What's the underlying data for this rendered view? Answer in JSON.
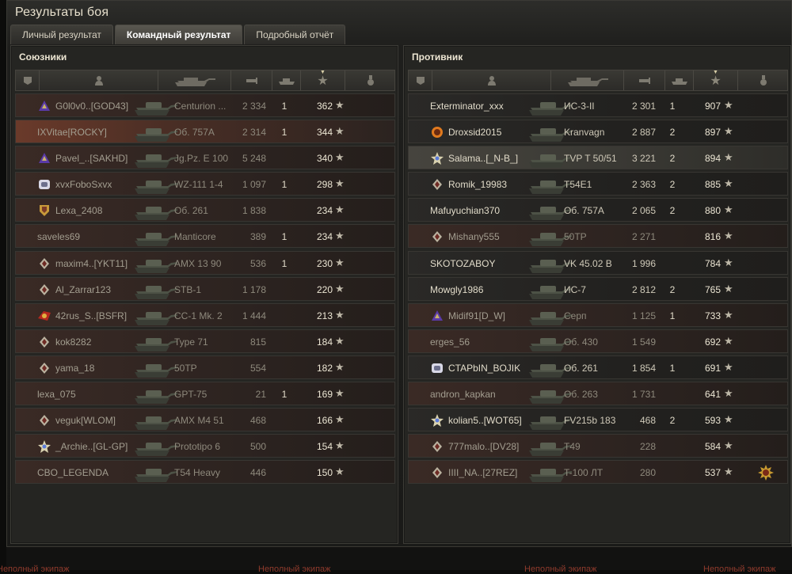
{
  "window": {
    "title": "Результаты боя"
  },
  "tabs": [
    {
      "label": "Личный результат"
    },
    {
      "label": "Командный результат"
    },
    {
      "label": "Подробный отчёт"
    }
  ],
  "allies": {
    "title": "Союзники",
    "rows": [
      {
        "player": "G0l0v0..[GOD43]",
        "tank": "Centurion ...",
        "damage": "2 334",
        "kills": "1",
        "xp": "362",
        "badge": "purple-badge-icon",
        "state": "dead"
      },
      {
        "player": "IXVitae[ROCKY]",
        "tank": "Об. 757А",
        "damage": "2 314",
        "kills": "1",
        "xp": "344",
        "badge": "",
        "state": "me"
      },
      {
        "player": "Pavel_..[SAKHD]",
        "tank": "Jg.Pz. E 100",
        "damage": "5 248",
        "kills": "",
        "xp": "340",
        "badge": "purple-badge-icon",
        "state": "dead"
      },
      {
        "player": "xvxFoboSxvx",
        "tank": "WZ-111 1-4",
        "damage": "1 097",
        "kills": "1",
        "xp": "298",
        "badge": "white-badge-icon",
        "state": "dead"
      },
      {
        "player": "Lexa_2408",
        "tank": "Об. 261",
        "damage": "1 838",
        "kills": "",
        "xp": "234",
        "badge": "gold-shield-icon",
        "state": "dead"
      },
      {
        "player": "saveles69",
        "tank": "Manticore",
        "damage": "389",
        "kills": "1",
        "xp": "234",
        "badge": "",
        "state": "dead"
      },
      {
        "player": "maxim4..[YKT11]",
        "tank": "AMX 13 90",
        "damage": "536",
        "kills": "1",
        "xp": "230",
        "badge": "diamond-icon",
        "state": "dead"
      },
      {
        "player": "Al_Zarrar123",
        "tank": "STB-1",
        "damage": "1 178",
        "kills": "",
        "xp": "220",
        "badge": "diamond-icon",
        "state": "dead"
      },
      {
        "player": "42rus_S..[BSFR]",
        "tank": "CC-1 Mk. 2",
        "damage": "1 444",
        "kills": "",
        "xp": "213",
        "badge": "red-badge-icon",
        "state": "dead"
      },
      {
        "player": "kok8282",
        "tank": "Type 71",
        "damage": "815",
        "kills": "",
        "xp": "184",
        "badge": "diamond-icon",
        "state": "dead"
      },
      {
        "player": "yama_18",
        "tank": "50TP",
        "damage": "554",
        "kills": "",
        "xp": "182",
        "badge": "diamond-icon",
        "state": "dead"
      },
      {
        "player": "lexa_075",
        "tank": "GPT-75",
        "damage": "21",
        "kills": "1",
        "xp": "169",
        "badge": "",
        "state": "dead"
      },
      {
        "player": "veguk[WLOM]",
        "tank": "AMX M4 51",
        "damage": "468",
        "kills": "",
        "xp": "166",
        "badge": "diamond-icon",
        "state": "dead"
      },
      {
        "player": "_Archie..[GL-GP]",
        "tank": "Prototipo 6",
        "damage": "500",
        "kills": "",
        "xp": "154",
        "badge": "star-badge-icon",
        "state": "dead"
      },
      {
        "player": "CBO_LEGENDA",
        "tank": "T54 Heavy",
        "damage": "446",
        "kills": "",
        "xp": "150",
        "badge": "",
        "state": "dead"
      }
    ]
  },
  "enemies": {
    "title": "Противник",
    "rows": [
      {
        "player": "Exterminator_xxx",
        "tank": "ИС-3-II",
        "damage": "2 301",
        "kills": "1",
        "xp": "907",
        "badge": "",
        "state": "alive"
      },
      {
        "player": "Droxsid2015",
        "tank": "Kranvagn",
        "damage": "2 887",
        "kills": "2",
        "xp": "897",
        "badge": "orange-badge-icon",
        "state": "alive"
      },
      {
        "player": "Salama..[_N-B_]",
        "tank": "TVP T 50/51",
        "damage": "3 221",
        "kills": "2",
        "xp": "894",
        "badge": "star-badge-icon",
        "state": "hl"
      },
      {
        "player": "Romik_19983",
        "tank": "T54E1",
        "damage": "2 363",
        "kills": "2",
        "xp": "885",
        "badge": "diamond-icon",
        "state": "alive"
      },
      {
        "player": "Mafuyuchian370",
        "tank": "Об. 757А",
        "damage": "2 065",
        "kills": "2",
        "xp": "880",
        "badge": "",
        "state": "alive"
      },
      {
        "player": "Mishany555",
        "tank": "50TP",
        "damage": "2 271",
        "kills": "",
        "xp": "816",
        "badge": "diamond-icon",
        "state": "dead"
      },
      {
        "player": "SKOTOZABOY",
        "tank": "VK 45.02 B",
        "damage": "1 996",
        "kills": "",
        "xp": "784",
        "badge": "",
        "state": "alive"
      },
      {
        "player": "Mowgly1986",
        "tank": "ИС-7",
        "damage": "2 812",
        "kills": "2",
        "xp": "765",
        "badge": "",
        "state": "alive"
      },
      {
        "player": "Midif91[D_W]",
        "tank": "Серп",
        "damage": "1 125",
        "kills": "1",
        "xp": "733",
        "badge": "purple-badge-icon",
        "state": "dead"
      },
      {
        "player": "erges_56",
        "tank": "Об. 430",
        "damage": "1 549",
        "kills": "",
        "xp": "692",
        "badge": "",
        "state": "dead"
      },
      {
        "player": "CTAPbIN_BOJIK",
        "tank": "Об. 261",
        "damage": "1 854",
        "kills": "1",
        "xp": "691",
        "badge": "white-badge-icon",
        "state": "alive"
      },
      {
        "player": "andron_kapkan",
        "tank": "Об. 263",
        "damage": "1 731",
        "kills": "",
        "xp": "641",
        "badge": "",
        "state": "dead"
      },
      {
        "player": "kolian5..[WOT65]",
        "tank": "FV215b 183",
        "damage": "468",
        "kills": "2",
        "xp": "593",
        "badge": "star-badge-icon",
        "state": "alive"
      },
      {
        "player": "777malo..[DV28]",
        "tank": "T49",
        "damage": "228",
        "kills": "",
        "xp": "584",
        "badge": "diamond-icon",
        "state": "dead"
      },
      {
        "player": "IIII_NA..[27REZ]",
        "tank": "T-100 ЛТ",
        "damage": "280",
        "kills": "",
        "xp": "537",
        "badge": "diamond-icon",
        "state": "dead",
        "medal": "sun-medal-icon"
      }
    ]
  },
  "columns": [
    "badge-icon",
    "player-icon",
    "tank-icon",
    "damage-icon",
    "kills-icon",
    "xp-star-icon",
    "medal-icon"
  ],
  "footer": {
    "items": [
      "Неполный экипаж",
      "Неполный экипаж",
      "Неполный экипаж",
      "Неполный экипаж"
    ]
  }
}
